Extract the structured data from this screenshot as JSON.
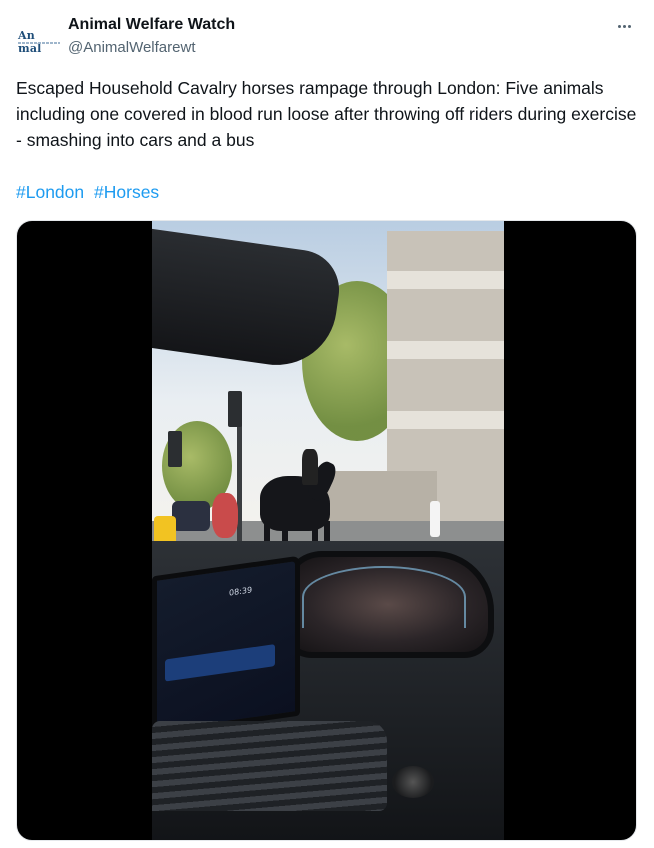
{
  "author": {
    "name": "Animal Welfare Watch",
    "handle": "@AnimalWelfarewt",
    "avatar_text": "An mal"
  },
  "tweet": {
    "text": "Escaped Household Cavalry horses rampage through London: Five animals including one covered in blood run loose after throwing off riders during exercise - smashing into cars and a bus",
    "hashtags": [
      "#London",
      "#Horses"
    ]
  },
  "media": {
    "type": "video",
    "screen_time": "08:39"
  },
  "icons": {
    "more": "more-options-icon"
  },
  "colors": {
    "link": "#1d9bf0",
    "secondary_text": "#536471",
    "primary_text": "#0f1419"
  }
}
